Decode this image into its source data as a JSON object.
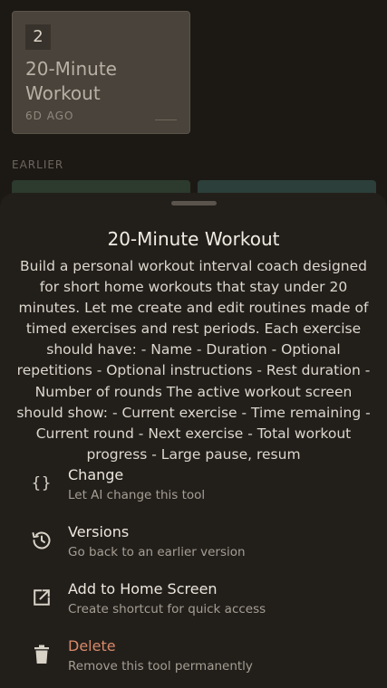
{
  "background": {
    "card": {
      "number": "2",
      "title": "20-Minute Workout",
      "date": "6D AGO"
    },
    "section_label": "EARLIER"
  },
  "sheet": {
    "title": "20-Minute Workout",
    "description": "Build a personal workout interval coach designed for short home workouts that stay under 20 minutes. Let me create and edit routines made of timed exercises and rest periods. Each exercise should have: - Name - Duration - Optional repetitions - Optional instructions - Rest duration - Number of rounds The active workout screen should show: - Current exercise - Time remaining - Current round - Next exercise - Total workout progress - Large pause, resum",
    "menu": [
      {
        "icon": "braces-icon",
        "label": "Change",
        "sub": "Let AI change this tool"
      },
      {
        "icon": "history-icon",
        "label": "Versions",
        "sub": "Go back to an earlier version"
      },
      {
        "icon": "external-link-icon",
        "label": "Add to Home Screen",
        "sub": "Create shortcut for quick access"
      },
      {
        "icon": "trash-icon",
        "label": "Delete",
        "sub": "Remove this tool permanently",
        "color": "#d98a6a"
      }
    ]
  }
}
